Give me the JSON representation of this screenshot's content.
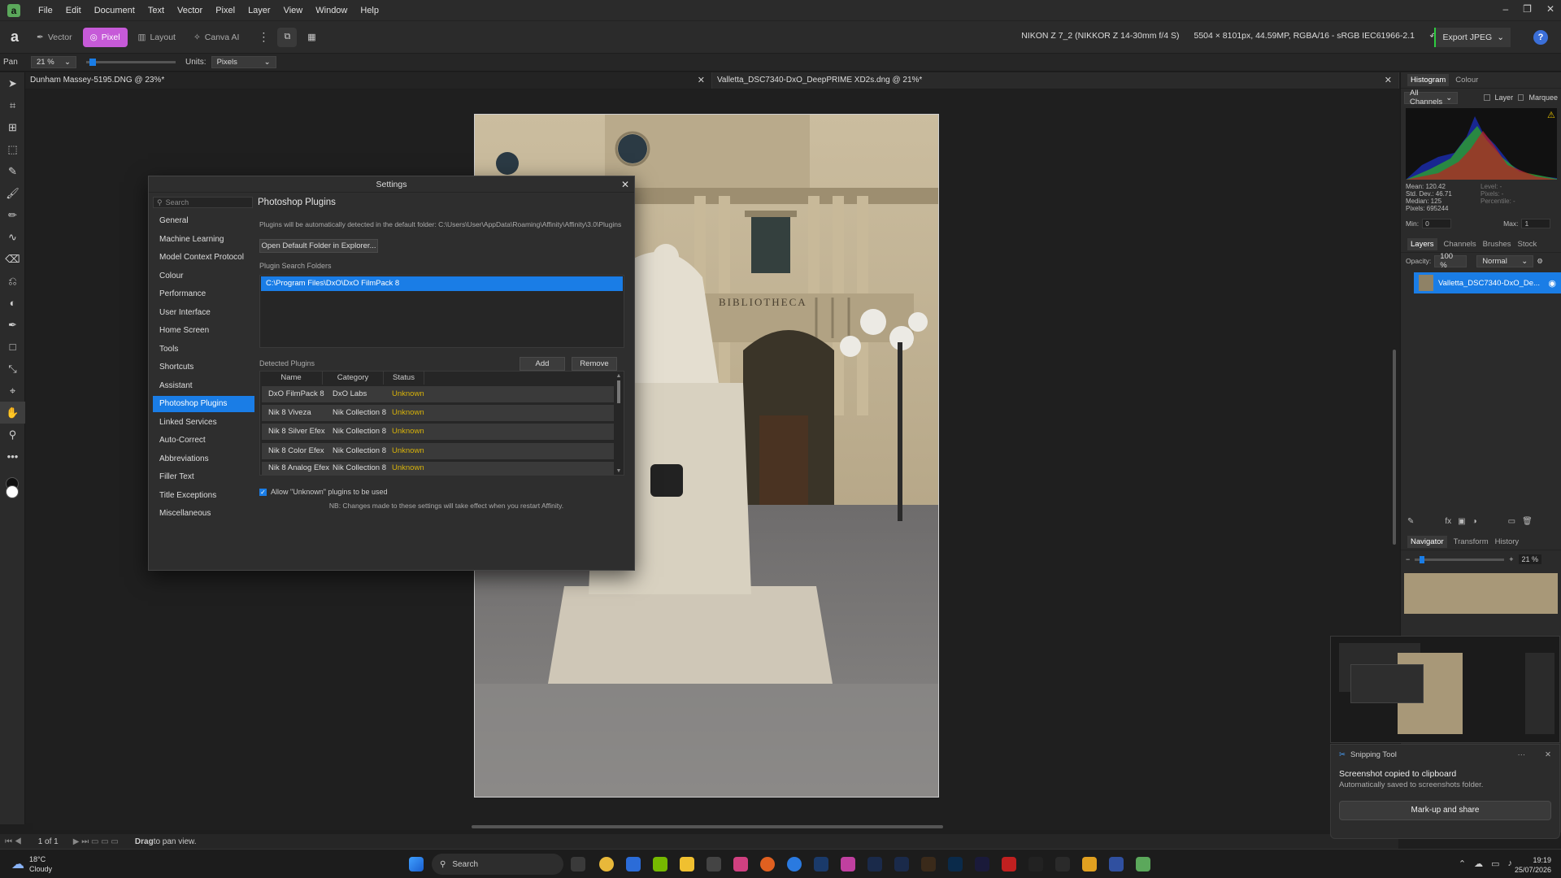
{
  "menubar": {
    "items": [
      "File",
      "Edit",
      "Document",
      "Text",
      "Vector",
      "Pixel",
      "Layer",
      "View",
      "Window",
      "Help"
    ],
    "window_controls": [
      "–",
      "❐",
      "✕"
    ]
  },
  "toolbar": {
    "personas": [
      {
        "label": "Vector",
        "icon": "pen-icon",
        "active": false
      },
      {
        "label": "Pixel",
        "icon": "pixel-icon",
        "active": true
      },
      {
        "label": "Layout",
        "icon": "layout-icon",
        "active": false
      },
      {
        "label": "Canva AI",
        "icon": "sparkle-icon",
        "active": false
      }
    ],
    "camera_info": "NIKON Z 7_2 (NIKKOR Z 14-30mm f/4 S)",
    "image_info": "5504 × 8101px, 44.59MP, RGBA/16 - sRGB IEC61966-2.1",
    "export_label": "Export JPEG",
    "help_label": "?"
  },
  "context": {
    "tool_label": "Pan",
    "zoom_value": "21 %",
    "units_label": "Units:",
    "units_value": "Pixels"
  },
  "tabs": [
    {
      "label": "Dunham Massey-5195.DNG @ 23%*"
    },
    {
      "label": "Valletta_DSC7340-DxO_DeepPRIME XD2s.dng @ 21%*"
    }
  ],
  "status": {
    "page": "1 of 1",
    "hint_bold": "Drag",
    "hint_rest": " to pan view."
  },
  "settings": {
    "title": "Settings",
    "search_placeholder": "Search",
    "nav": [
      "General",
      "Machine Learning",
      "Model Context Protocol",
      "Colour",
      "Performance",
      "User Interface",
      "Home Screen",
      "Tools",
      "Shortcuts",
      "Assistant",
      "Photoshop Plugins",
      "Linked Services",
      "Auto-Correct",
      "Abbreviations",
      "Filler Text",
      "Title Exceptions",
      "Miscellaneous"
    ],
    "active_nav": "Photoshop Plugins",
    "heading": "Photoshop Plugins",
    "info": "Plugins will be automatically detected in the default folder: C:\\Users\\User\\AppData\\Roaming\\Affinity\\Affinity\\3.0\\Plugins",
    "open_folder_label": "Open Default Folder in Explorer...",
    "search_folders_label": "Plugin Search Folders",
    "folders": [
      "C:\\Program Files\\DxO\\DxO FilmPack 8"
    ],
    "detected_label": "Detected Plugins",
    "add_label": "Add",
    "remove_label": "Remove",
    "columns": [
      "Name",
      "Category",
      "Status"
    ],
    "plugins": [
      {
        "name": "DxO FilmPack 8",
        "category": "DxO Labs",
        "status": "Unknown"
      },
      {
        "name": "Nik 8 Viveza",
        "category": "Nik Collection 8",
        "status": "Unknown"
      },
      {
        "name": "Nik 8 Silver Efex",
        "category": "Nik Collection 8",
        "status": "Unknown"
      },
      {
        "name": "Nik 8 Color Efex",
        "category": "Nik Collection 8",
        "status": "Unknown"
      },
      {
        "name": "Nik 8 Analog Efex",
        "category": "Nik Collection 8",
        "status": "Unknown"
      }
    ],
    "allow_unknown_label": "Allow \"Unknown\" plugins to be used",
    "allow_unknown_checked": true,
    "note": "NB: Changes made to these settings will take effect when you restart Affinity."
  },
  "histogram": {
    "tabs": [
      "Histogram",
      "Colour"
    ],
    "channel": "All Channels",
    "layer_label": "Layer",
    "marquee_label": "Marquee",
    "stats_left": [
      "Mean: 120.42",
      "Std. Dev.: 46.71",
      "Median: 125",
      "Pixels: 695244"
    ],
    "stats_right": [
      "Level: -",
      "Pixels: -",
      "Percentile: -"
    ],
    "min_label": "Min:",
    "min_value": "0",
    "max_label": "Max:",
    "max_value": "1"
  },
  "layers": {
    "tabs": [
      "Layers",
      "Channels",
      "Brushes",
      "Stock"
    ],
    "opacity_label": "Opacity:",
    "opacity_value": "100 %",
    "blend_mode": "Normal",
    "layer_name": "Valletta_DSC7340-DxO_De..."
  },
  "navigator": {
    "tabs": [
      "Navigator",
      "Transform",
      "History"
    ],
    "zoom": "21 %"
  },
  "toast": {
    "app": "Snipping Tool",
    "title": "Screenshot copied to clipboard",
    "subtitle": "Automatically saved to screenshots folder.",
    "action": "Mark-up and share",
    "more": "···",
    "close": "✕"
  },
  "taskbar": {
    "temp": "18°C",
    "weather": "Cloudy",
    "search": "Search",
    "time": "19:19",
    "date": "25/07/2026"
  }
}
